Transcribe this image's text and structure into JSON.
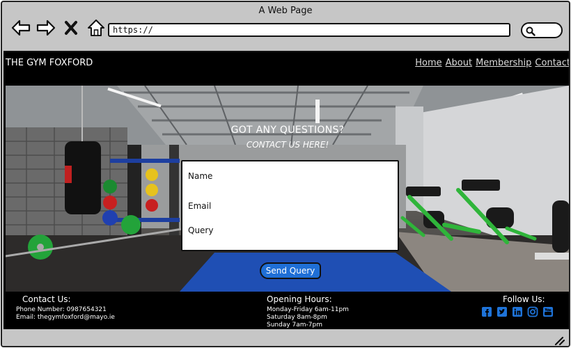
{
  "window": {
    "title": "A Web Page"
  },
  "browser": {
    "url": "https://"
  },
  "site": {
    "brand": "THE GYM FOXFORD",
    "menu": [
      "Home",
      "About",
      "Membership",
      "Contact"
    ]
  },
  "hero": {
    "title": "GOT ANY QUESTIONS?",
    "subtitle": "CONTACT US HERE!"
  },
  "form": {
    "name_label": "Name",
    "email_label": "Email",
    "query_label": "Query",
    "submit_label": "Send Query"
  },
  "footer": {
    "contact_title": "Contact Us:",
    "phone": "Phone Number: 0987654321",
    "email": "Email: thegymfoxford@mayo.ie",
    "hours_title": "Opening Hours:",
    "hours": [
      "Monday-Friday 6am-11pm",
      "Saturday 8am-8pm",
      "Sunday 7am-7pm"
    ],
    "follow_title": "Follow Us:",
    "socials": [
      "facebook-icon",
      "twitter-icon",
      "linkedin-icon",
      "instagram-icon",
      "youtube-icon"
    ]
  },
  "colors": {
    "accent": "#1f6fd6",
    "social": "#1e73d8",
    "header_bg": "#000000"
  }
}
